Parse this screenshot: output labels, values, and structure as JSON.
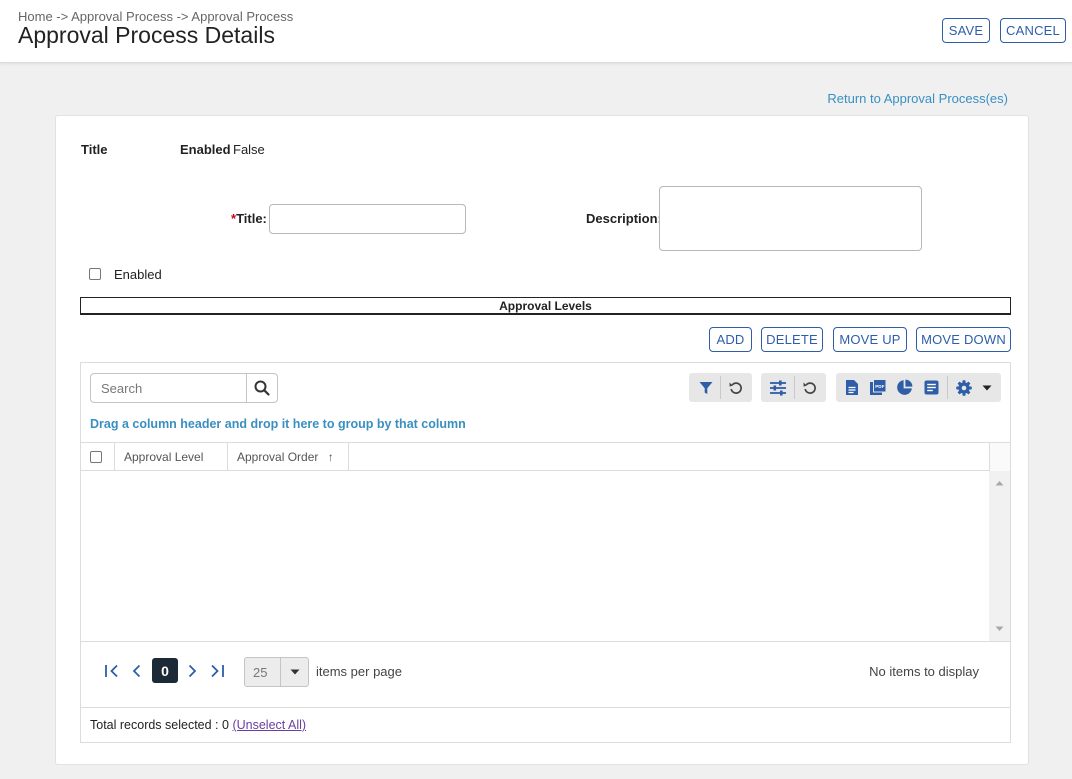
{
  "header": {
    "breadcrumb": "Home -> Approval Process -> Approval Process",
    "title": "Approval Process Details",
    "save_label": "SAVE",
    "cancel_label": "CANCEL"
  },
  "return_link": "Return to Approval Process(es)",
  "summary": {
    "title_label": "Title",
    "enabled_label": "Enabled",
    "enabled_value": "False"
  },
  "form": {
    "required_mark": "*",
    "title_label": "Title:",
    "title_value": "",
    "description_label": "Description:",
    "description_value": "",
    "enabled_label": "Enabled",
    "enabled_checked": false
  },
  "approval_levels": {
    "section_title": "Approval Levels",
    "buttons": {
      "add": "ADD",
      "delete": "DELETE",
      "move_up": "MOVE UP",
      "move_down": "MOVE DOWN"
    },
    "grid": {
      "search_placeholder": "Search",
      "group_hint": "Drag a column header and drop it here to group by that column",
      "columns": [
        {
          "label": "Approval Level",
          "sort": ""
        },
        {
          "label": "Approval Order",
          "sort": "↑"
        }
      ],
      "rows": [],
      "toolbar_icons": [
        "filter-icon",
        "reset-filter-icon",
        "column-settings-icon",
        "reset-columns-icon",
        "export-document-icon",
        "export-pdf-icon",
        "chart-icon",
        "report-icon",
        "settings-gear-icon",
        "dropdown-caret-icon"
      ],
      "pager": {
        "current_page": "0",
        "page_size": "25",
        "items_per_page_label": "items per page",
        "status": "No items to display"
      },
      "footer": {
        "total_selected_label": "Total records selected : 0",
        "unselect_all": "(Unselect All)"
      }
    }
  },
  "colors": {
    "accent": "#2e5ea8",
    "link": "#3a8fc1",
    "required": "#d0021b",
    "pager_active": "#1b2a36"
  }
}
